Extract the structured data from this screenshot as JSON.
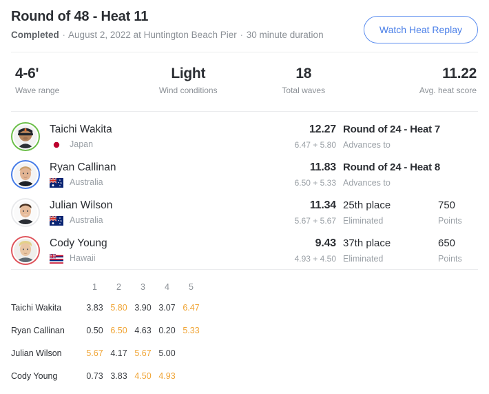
{
  "header": {
    "title": "Round of 48 - Heat 11",
    "status": "Completed",
    "sep1": "·",
    "date_location": "August 2, 2022 at Huntington Beach Pier",
    "sep2": "·",
    "duration": "30 minute duration",
    "replay_button": "Watch Heat Replay",
    "accent_blue": "#4a7fe8"
  },
  "stats": [
    {
      "value": "4-6'",
      "label": "Wave range"
    },
    {
      "value": "Light",
      "label": "Wind conditions"
    },
    {
      "value": "18",
      "label": "Total waves"
    },
    {
      "value": "11.22",
      "label": "Avg. heat score"
    }
  ],
  "surfers": [
    {
      "name": "Taichi Wakita",
      "country": "Japan",
      "flag": "japan-flag",
      "ring_color": "#6dbf4b",
      "total": "12.27",
      "parts": "6.47 + 5.80",
      "result_main": "Round of 24 - Heat 7",
      "result_sub": "Advances to",
      "points_value": "",
      "points_label": ""
    },
    {
      "name": "Ryan Callinan",
      "country": "Australia",
      "flag": "australia-flag",
      "ring_color": "#4a7fe8",
      "total": "11.83",
      "parts": "6.50 + 5.33",
      "result_main": "Round of 24 - Heat 8",
      "result_sub": "Advances to",
      "points_value": "",
      "points_label": ""
    },
    {
      "name": "Julian Wilson",
      "country": "Australia",
      "flag": "australia-flag",
      "ring_color": "#e9eaec",
      "total": "11.34",
      "parts": "5.67 + 5.67",
      "result_main": "25th place",
      "result_sub": "Eliminated",
      "points_value": "750",
      "points_label": "Points"
    },
    {
      "name": "Cody Young",
      "country": "Hawaii",
      "flag": "hawaii-flag",
      "ring_color": "#e0575f",
      "total": "9.43",
      "parts": "4.93 + 4.50",
      "result_main": "37th place",
      "result_sub": "Eliminated",
      "points_value": "650",
      "points_label": "Points"
    }
  ],
  "wave_table": {
    "columns": [
      "1",
      "2",
      "3",
      "4",
      "5"
    ],
    "counted_color": "#f0a434",
    "rows": [
      {
        "name": "Taichi Wakita",
        "scores": [
          "3.83",
          "5.80",
          "3.90",
          "3.07",
          "6.47"
        ],
        "counted": [
          false,
          true,
          false,
          false,
          true
        ]
      },
      {
        "name": "Ryan Callinan",
        "scores": [
          "0.50",
          "6.50",
          "4.63",
          "0.20",
          "5.33"
        ],
        "counted": [
          false,
          true,
          false,
          false,
          true
        ]
      },
      {
        "name": "Julian Wilson",
        "scores": [
          "5.67",
          "4.17",
          "5.67",
          "5.00",
          ""
        ],
        "counted": [
          true,
          false,
          true,
          false,
          false
        ]
      },
      {
        "name": "Cody Young",
        "scores": [
          "0.73",
          "3.83",
          "4.50",
          "4.93",
          ""
        ],
        "counted": [
          false,
          false,
          true,
          true,
          false
        ]
      }
    ]
  }
}
